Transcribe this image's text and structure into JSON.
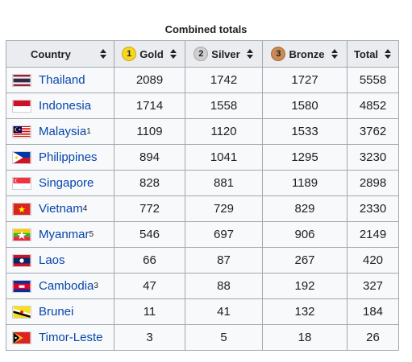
{
  "caption": "Combined totals",
  "headers": {
    "country": "Country",
    "gold": "Gold",
    "silver": "Silver",
    "bronze": "Bronze",
    "total": "Total",
    "gold_badge": "1",
    "silver_badge": "2",
    "bronze_badge": "3"
  },
  "rows": [
    {
      "country": "Thailand",
      "note": "",
      "gold": "2089",
      "silver": "1742",
      "bronze": "1727",
      "total": "5558",
      "flag": "flag-thailand"
    },
    {
      "country": "Indonesia",
      "note": "",
      "gold": "1714",
      "silver": "1558",
      "bronze": "1580",
      "total": "4852",
      "flag": "flag-indonesia"
    },
    {
      "country": "Malaysia",
      "note": "1",
      "gold": "1109",
      "silver": "1120",
      "bronze": "1533",
      "total": "3762",
      "flag": "flag-malaysia"
    },
    {
      "country": "Philippines",
      "note": "",
      "gold": "894",
      "silver": "1041",
      "bronze": "1295",
      "total": "3230",
      "flag": "flag-philippines"
    },
    {
      "country": "Singapore",
      "note": "",
      "gold": "828",
      "silver": "881",
      "bronze": "1189",
      "total": "2898",
      "flag": "flag-singapore"
    },
    {
      "country": "Vietnam",
      "note": "4",
      "gold": "772",
      "silver": "729",
      "bronze": "829",
      "total": "2330",
      "flag": "flag-vietnam"
    },
    {
      "country": "Myanmar",
      "note": "5",
      "gold": "546",
      "silver": "697",
      "bronze": "906",
      "total": "2149",
      "flag": "flag-myanmar"
    },
    {
      "country": "Laos",
      "note": "",
      "gold": "66",
      "silver": "87",
      "bronze": "267",
      "total": "420",
      "flag": "flag-laos"
    },
    {
      "country": "Cambodia",
      "note": "3",
      "gold": "47",
      "silver": "88",
      "bronze": "192",
      "total": "327",
      "flag": "flag-cambodia"
    },
    {
      "country": "Brunei",
      "note": "",
      "gold": "11",
      "silver": "41",
      "bronze": "132",
      "total": "184",
      "flag": "flag-brunei"
    },
    {
      "country": "Timor-Leste",
      "note": "",
      "gold": "3",
      "silver": "5",
      "bronze": "18",
      "total": "26",
      "flag": "flag-timor-leste"
    }
  ],
  "colors": {
    "link": "#0645ad",
    "header_bg": "#eaecf0",
    "cell_bg": "#f8f9fa",
    "border": "#a2a9b1",
    "gold": "#f9d71c",
    "silver": "#cfcfcf",
    "bronze": "#c98a53"
  }
}
